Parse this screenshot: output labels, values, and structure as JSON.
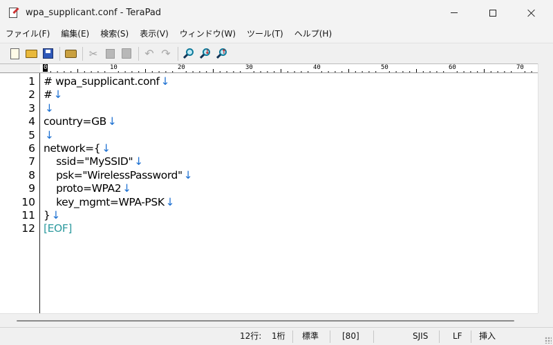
{
  "window": {
    "title": "wpa_supplicant.conf - TeraPad"
  },
  "menu": [
    "ファイル(F)",
    "編集(E)",
    "検索(S)",
    "表示(V)",
    "ウィンドウ(W)",
    "ツール(T)",
    "ヘルプ(H)"
  ],
  "toolbar": {
    "icons": [
      "new-file-icon",
      "open-folder-icon",
      "save-icon",
      "print-icon",
      "cut-icon",
      "copy-icon",
      "paste-icon",
      "undo-icon",
      "redo-icon",
      "find-icon",
      "find-next-icon",
      "find-prev-icon"
    ]
  },
  "ruler": {
    "labels": [
      "0",
      "10",
      "20",
      "30",
      "40",
      "50",
      "60",
      "70"
    ]
  },
  "editor": {
    "eol_mark": "↓",
    "lines": [
      {
        "no": "1",
        "text": "# wpa_supplicant.conf"
      },
      {
        "no": "2",
        "text": "#"
      },
      {
        "no": "3",
        "text": ""
      },
      {
        "no": "4",
        "text": "country=GB"
      },
      {
        "no": "5",
        "text": ""
      },
      {
        "no": "6",
        "text": "network={"
      },
      {
        "no": "7",
        "text": "    ssid=\"MySSID\""
      },
      {
        "no": "8",
        "text": "    psk=\"WirelessPassword\""
      },
      {
        "no": "9",
        "text": "    proto=WPA2"
      },
      {
        "no": "10",
        "text": "    key_mgmt=WPA-PSK"
      },
      {
        "no": "11",
        "text": "}"
      },
      {
        "no": "12",
        "text": "[EOF]",
        "eof": true
      }
    ]
  },
  "status": {
    "line": "12行:",
    "column": "1桁",
    "mode": "標準",
    "wrap": "[80]",
    "encoding": "SJIS",
    "newline": "LF",
    "insert": "挿入"
  },
  "colors": {
    "eol_mark": "#1b6fd1",
    "eof_mark": "#2d9a9e"
  }
}
